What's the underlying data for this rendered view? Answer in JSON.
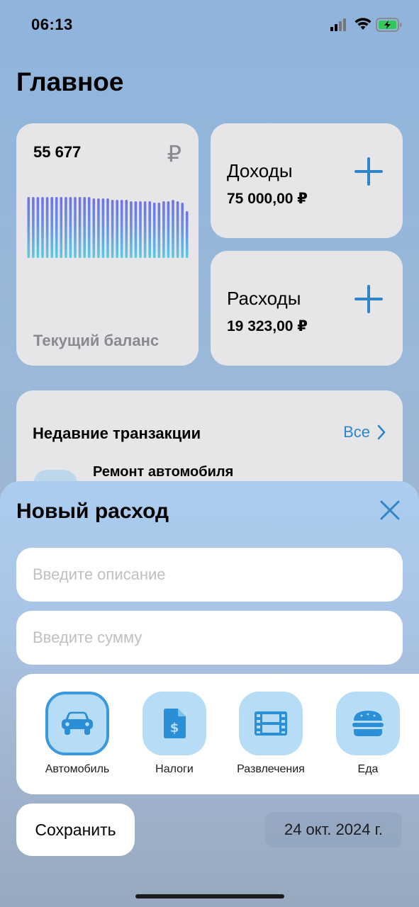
{
  "status_bar": {
    "time": "06:13"
  },
  "page": {
    "title": "Главное"
  },
  "balance_card": {
    "value": "55 677",
    "currency_icon": "₽",
    "label": "Текущий баланс"
  },
  "income_card": {
    "title": "Доходы",
    "amount": "75 000,00 ₽"
  },
  "expense_card": {
    "title": "Расходы",
    "amount": "19 323,00 ₽"
  },
  "recent": {
    "title": "Недавние транзакции",
    "all_label": "Все",
    "first_item": "Ремонт автомобиля"
  },
  "sheet": {
    "title": "Новый расход",
    "description_placeholder": "Введите описание",
    "amount_placeholder": "Введите сумму",
    "categories": [
      {
        "label": "Автомобиль",
        "icon": "car-icon",
        "selected": true
      },
      {
        "label": "Налоги",
        "icon": "tax-document-icon",
        "selected": false
      },
      {
        "label": "Развлечения",
        "icon": "film-icon",
        "selected": false
      },
      {
        "label": "Еда",
        "icon": "burger-icon",
        "selected": false
      }
    ],
    "save_label": "Сохранить",
    "date": "24 окт. 2024 г."
  },
  "colors": {
    "accent": "#2e86c9",
    "category_bg": "#b7dcf6",
    "selected_border": "#3a99dc"
  }
}
